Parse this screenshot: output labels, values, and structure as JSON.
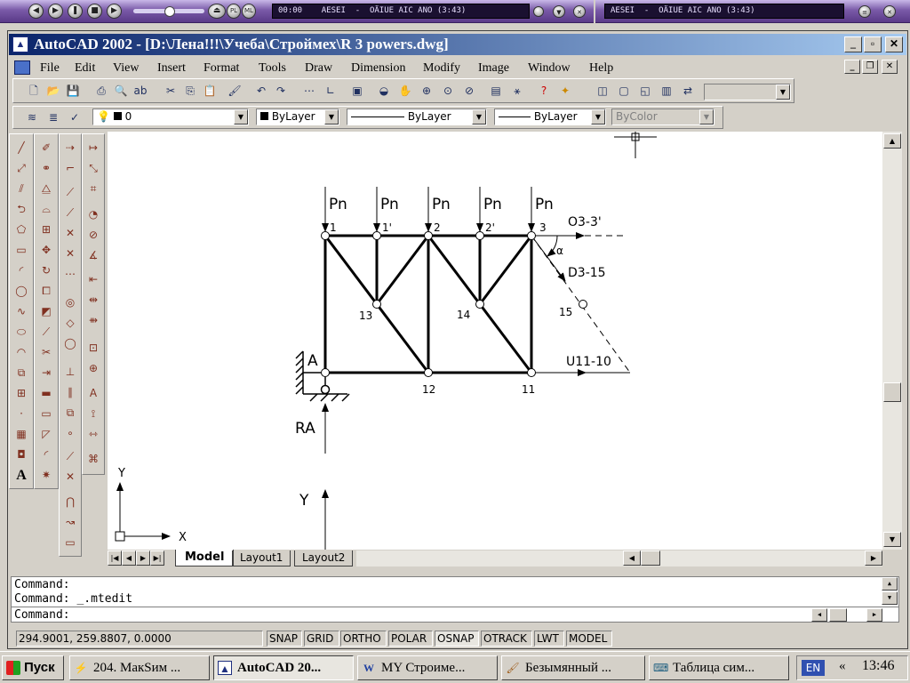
{
  "media_player": {
    "time_main": "00:00",
    "track_main": "AESEI  -  OÄIUE AIC ANO (3:43)",
    "track_second": "AESEI  -  OÄIUE AIC ANO (3:43)",
    "pl_label": "PL",
    "ml_label": "ML"
  },
  "window": {
    "title": "AutoCAD 2002 - [D:\\Лена!!!\\Учеба\\Строймех\\R 3 powers.dwg]"
  },
  "menu": [
    "File",
    "Edit",
    "View",
    "Insert",
    "Format",
    "Tools",
    "Draw",
    "Dimension",
    "Modify",
    "Image",
    "Window",
    "Help"
  ],
  "layers": {
    "layer_name": "0",
    "color": "ByLayer",
    "linetype": "ByLayer",
    "lineweight": "ByLayer",
    "plotstyle": "ByColor"
  },
  "drawing": {
    "loads": [
      "Pn",
      "Pn",
      "Pn",
      "Pn",
      "Pn"
    ],
    "top_nodes": [
      "1",
      "1'",
      "2",
      "2'",
      "3"
    ],
    "mid_nodes": [
      "13",
      "14"
    ],
    "bottom_nodes": [
      "12",
      "11"
    ],
    "node_15": "15",
    "support_label": "A",
    "reaction_label": "RA",
    "force_o": "O3-3'",
    "force_d": "D3-15",
    "force_u": "U11-10",
    "axis_y_label": "Y",
    "ucs_x": "X",
    "ucs_y": "Y",
    "angle_mark": "α"
  },
  "tabs": [
    "Model",
    "Layout1",
    "Layout2"
  ],
  "command": {
    "line1": "Command:",
    "line2": "Command: _.mtedit",
    "line3": "Command:"
  },
  "status": {
    "coords": "294.9001, 259.8807, 0.0000",
    "buttons": [
      "SNAP",
      "GRID",
      "ORTHO",
      "POLAR",
      "OSNAP",
      "OTRACK",
      "LWT",
      "MODEL"
    ]
  },
  "taskbar": {
    "start": "Пуск",
    "tasks": [
      "204. МакSим ...",
      "AutoCAD 20...",
      "MY Строиме...",
      "Безымянный ...",
      "Таблица сим..."
    ],
    "lang": "EN",
    "clock": "13:46"
  }
}
